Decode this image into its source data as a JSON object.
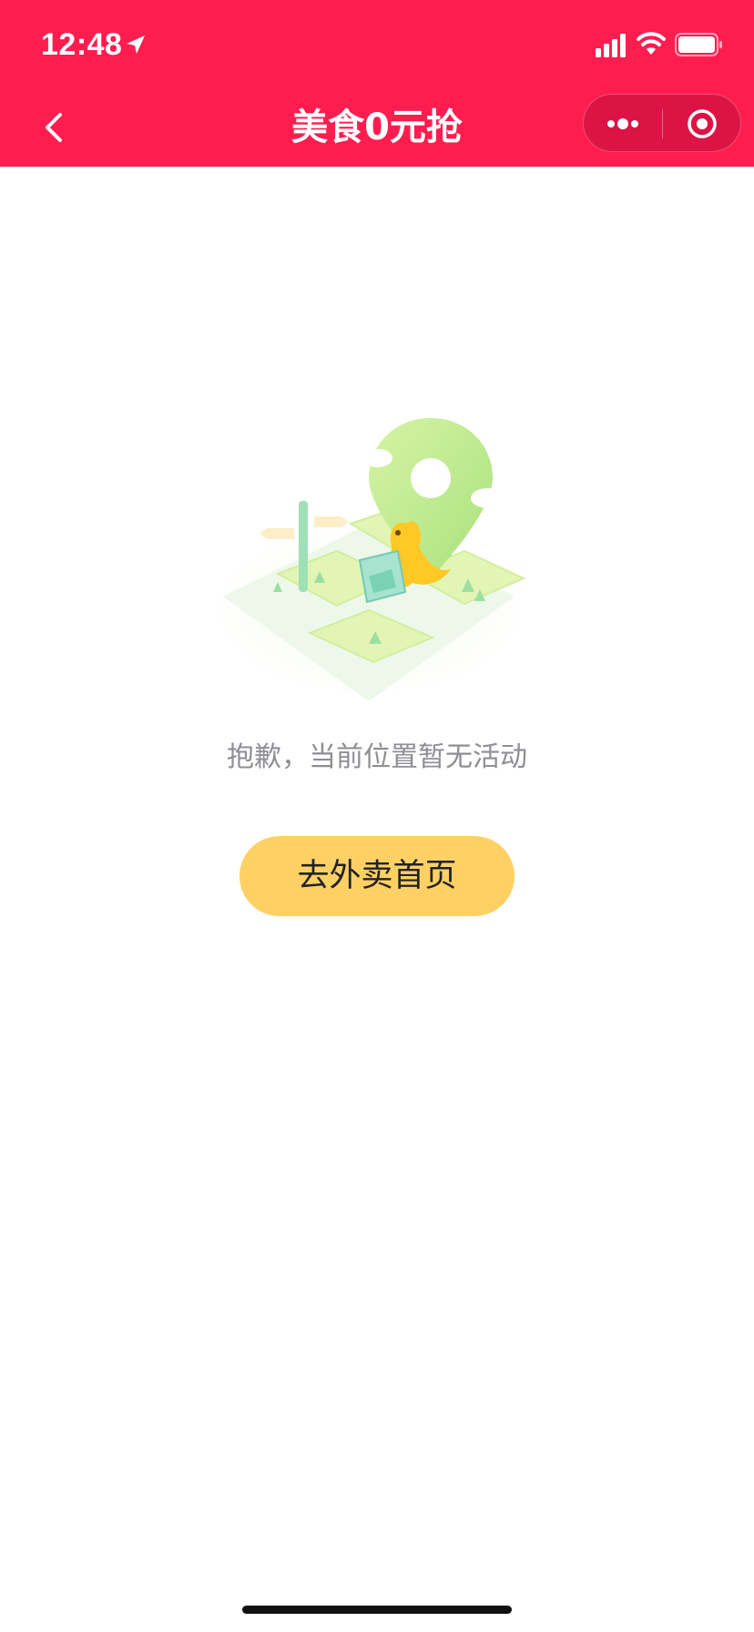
{
  "status_bar": {
    "time": "12:48"
  },
  "nav": {
    "title": "美食0元抢"
  },
  "empty_state": {
    "message": "抱歉，当前位置暂无活动",
    "button_label": "去外卖首页"
  },
  "colors": {
    "header_bg": "#ff1d4f",
    "button_bg": "#ffd165",
    "message_text": "#8e8e93"
  },
  "icons": {
    "back": "chevron-left-icon",
    "more": "more-dots-icon",
    "close": "target-circle-icon",
    "illustration": "map-pin-kangaroo-illustration"
  }
}
